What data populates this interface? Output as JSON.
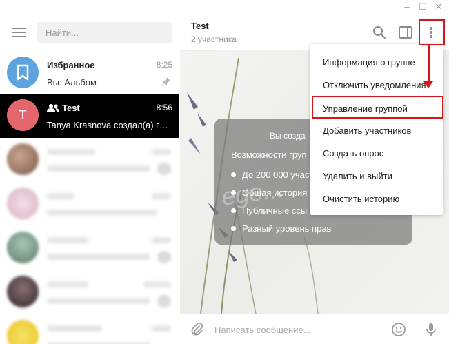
{
  "window": {
    "minimize": "–",
    "maximize": "☐",
    "close": "✕"
  },
  "sidebar": {
    "search_placeholder": "Найти...",
    "chats": [
      {
        "name": "Избранное",
        "time": "8:25",
        "preview": "Вы: Альбом",
        "avatar_color": "#5fa3de",
        "icon": "bookmark-icon",
        "pinned": true
      },
      {
        "name": "Test",
        "time": "8:56",
        "preview": "Tanya Krasnova создал(а) гр...",
        "avatar_color": "#e4666c",
        "avatar_letter": "T",
        "icon": "group-icon",
        "active": true
      }
    ]
  },
  "main": {
    "title": "Test",
    "subtitle": "2 участника",
    "info_card": {
      "title": "Вы созда",
      "subtitle": "Возможности груп",
      "items": [
        "До 200 000 участ",
        "Общая история",
        "Публичные ссы",
        "Разный уровень прав"
      ]
    },
    "watermark": "ege...",
    "composer_placeholder": "Написать сообщение..."
  },
  "menu": {
    "items": [
      "Информация о группе",
      "Отключить уведомления",
      "Управление группой",
      "Добавить участников",
      "Создать опрос",
      "Удалить и выйти",
      "Очистить историю"
    ]
  },
  "colors": {
    "accent": "#d6151b",
    "active_chat": "#000000",
    "avatar_test": "#e4666c",
    "avatar_saved": "#5fa3de"
  }
}
